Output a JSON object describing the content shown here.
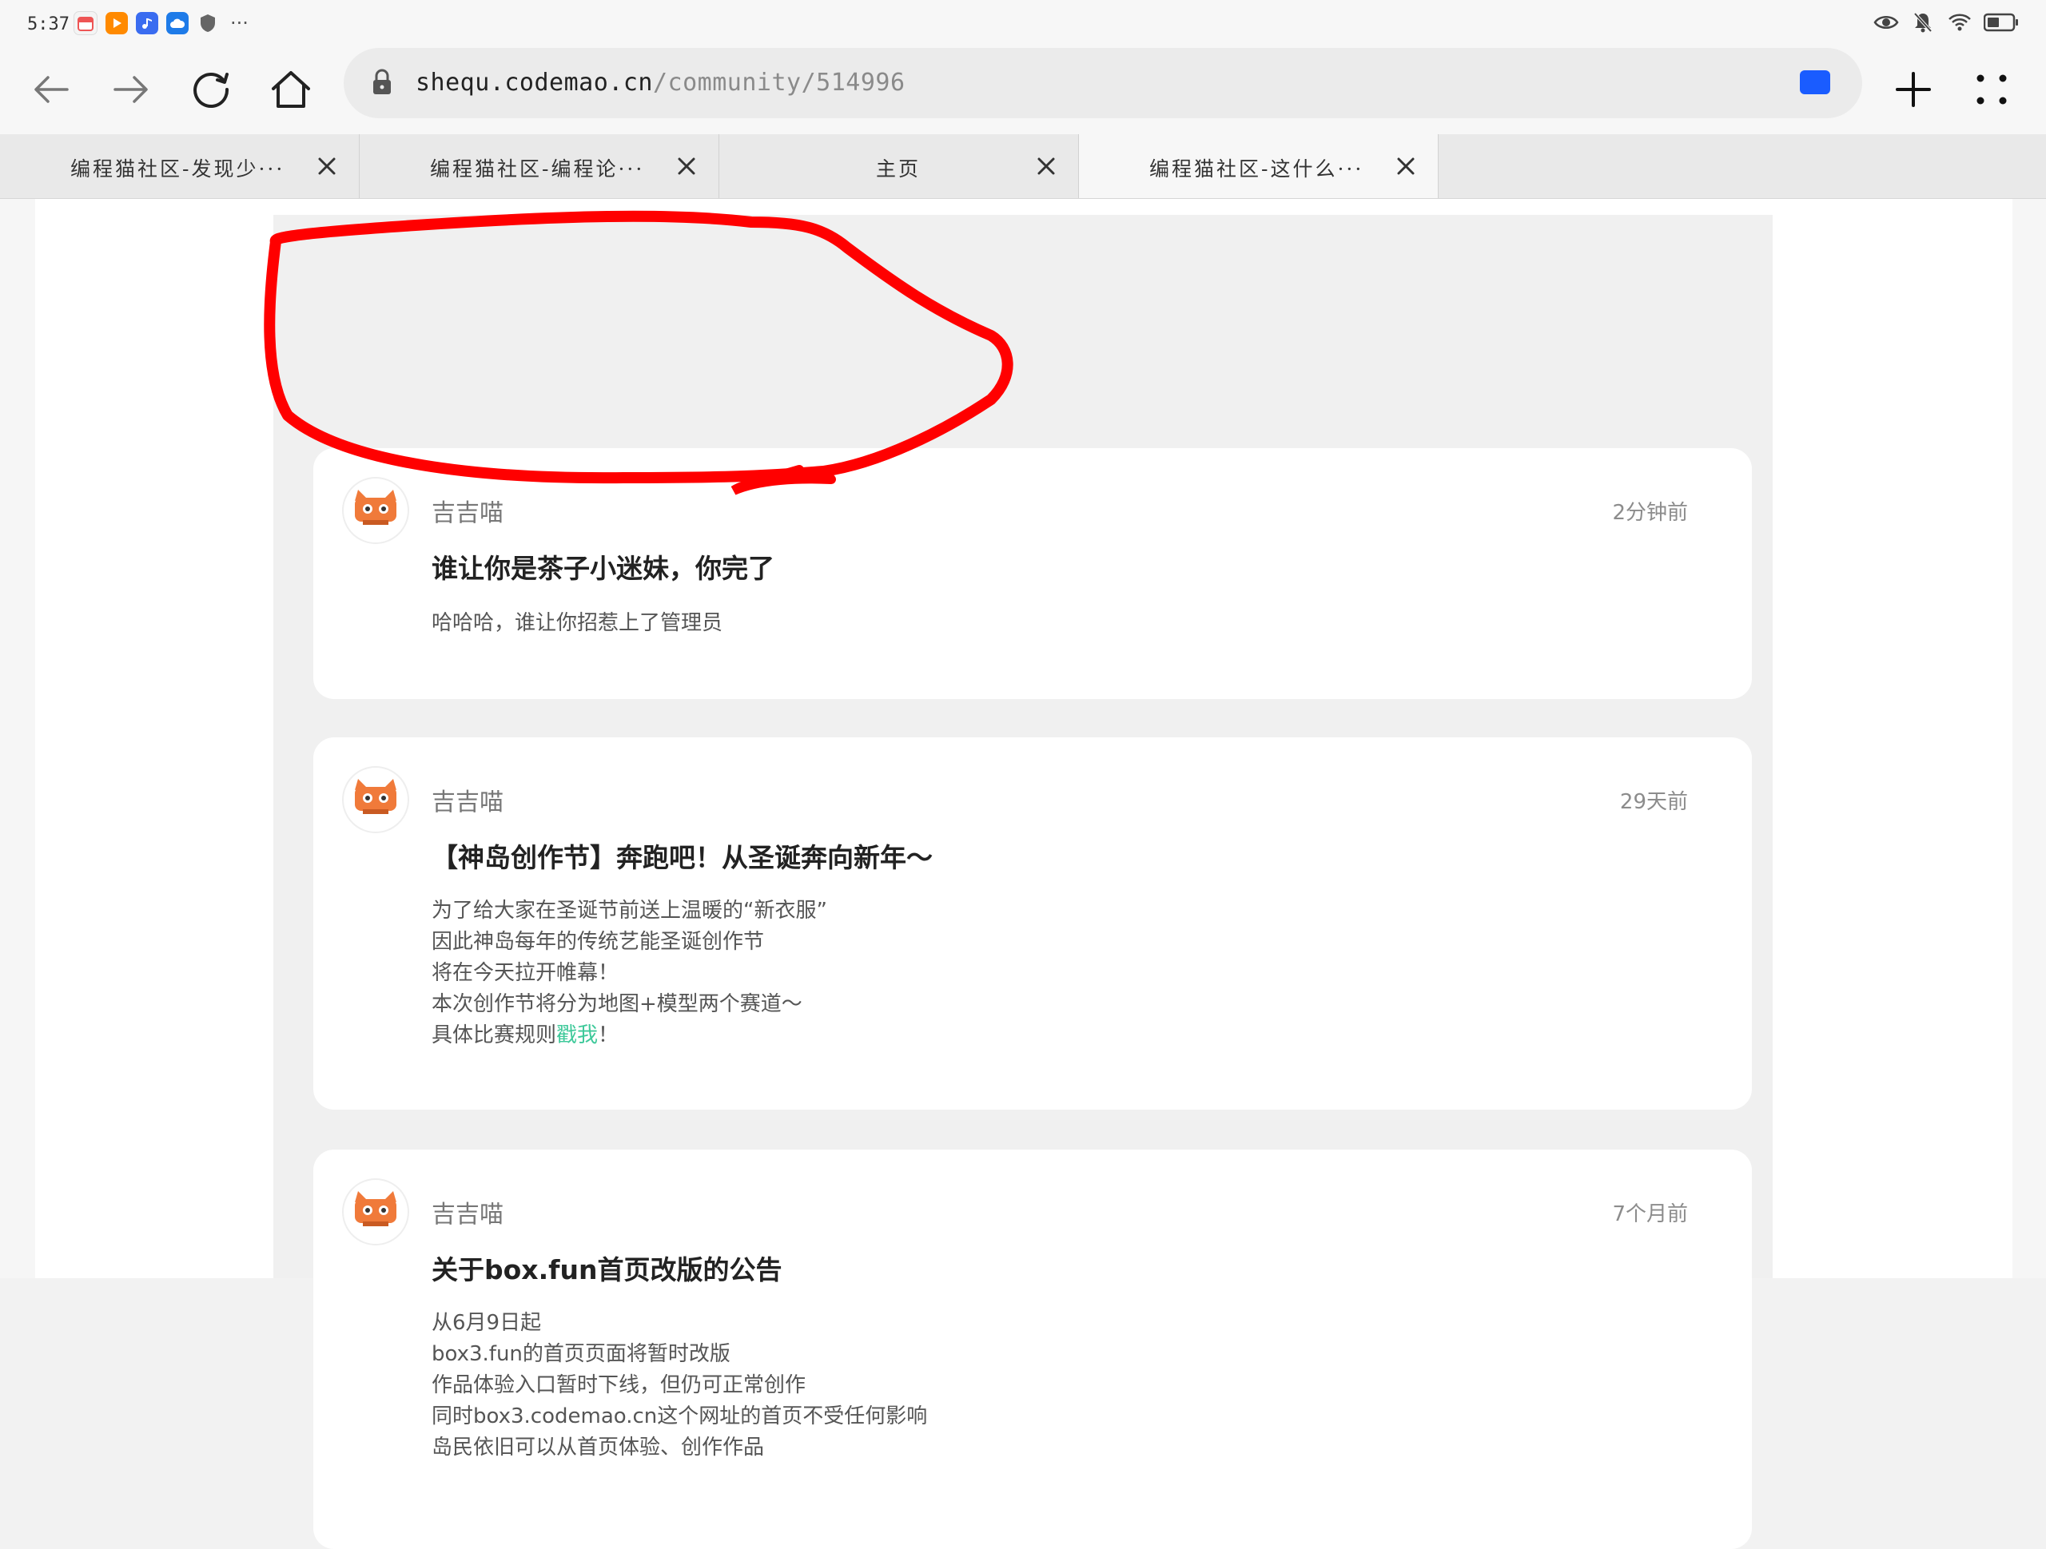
{
  "status_bar": {
    "time": "5:37",
    "app_icons": [
      "calendar-app-icon",
      "video-app-icon",
      "music-app-icon",
      "cloud-app-icon",
      "shield-app-icon"
    ],
    "more": "···",
    "right_icons": [
      "eye-icon",
      "mute-bell-icon",
      "wifi-icon",
      "battery-icon"
    ]
  },
  "toolbar": {
    "url_host": "shequ.codemao.cn",
    "url_path": "/community/514996"
  },
  "tabs": [
    {
      "title": "编程猫社区-发现少···",
      "active": false
    },
    {
      "title": "编程猫社区-编程论···",
      "active": false
    },
    {
      "title": "主页",
      "active": false
    },
    {
      "title": "编程猫社区-这什么···",
      "active": true
    }
  ],
  "posts": [
    {
      "author": "吉吉喵",
      "time": "2分钟前",
      "title": "谁让你是茶子小迷妹，你完了",
      "body": [
        "哈哈哈，谁让你招惹上了管理员"
      ]
    },
    {
      "author": "吉吉喵",
      "time": "29天前",
      "title": "【神岛创作节】奔跑吧！从圣诞奔向新年～",
      "body": [
        "为了给大家在圣诞节前送上温暖的“新衣服”",
        "因此神岛每年的传统艺能圣诞创作节",
        "将在今天拉开帷幕！",
        "本次创作节将分为地图+模型两个赛道～"
      ],
      "body_last_prefix": "具体比赛规则",
      "body_link": "戳我",
      "body_last_suffix": "！"
    },
    {
      "author": "吉吉喵",
      "time": "7个月前",
      "title": "关于box.fun首页改版的公告",
      "body": [
        "从6月9日起",
        "box3.fun的首页页面将暂时改版",
        "作品体验入口暂时下线，但仍可正常创作",
        "同时box3.codemao.cn这个网址的首页不受任何影响",
        "岛民依旧可以从首页体验、创作作品"
      ]
    }
  ],
  "colors": {
    "annotation": "#ff0000",
    "link": "#3ec99a",
    "screen_button": "#1a5cff"
  }
}
